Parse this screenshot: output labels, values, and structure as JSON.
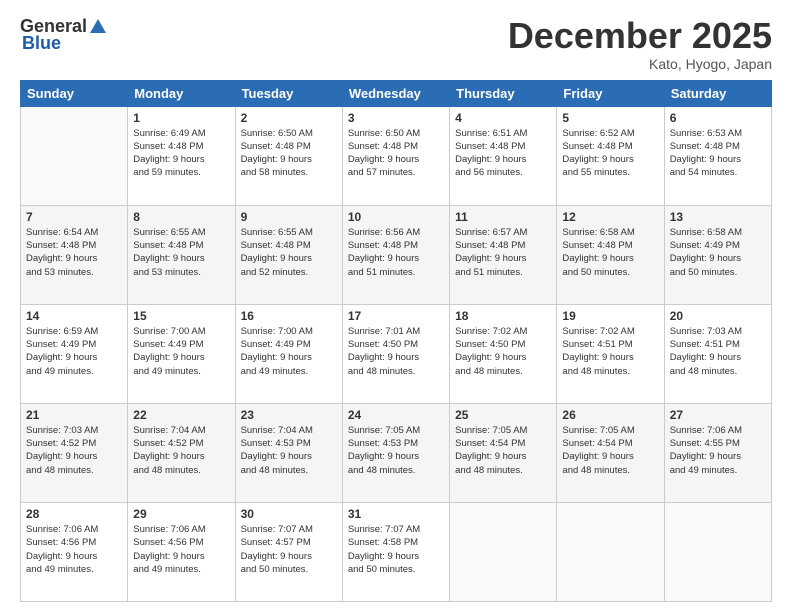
{
  "logo": {
    "general": "General",
    "blue": "Blue"
  },
  "title": "December 2025",
  "location": "Kato, Hyogo, Japan",
  "days_header": [
    "Sunday",
    "Monday",
    "Tuesday",
    "Wednesday",
    "Thursday",
    "Friday",
    "Saturday"
  ],
  "weeks": [
    [
      {
        "num": "",
        "info": ""
      },
      {
        "num": "1",
        "info": "Sunrise: 6:49 AM\nSunset: 4:48 PM\nDaylight: 9 hours\nand 59 minutes."
      },
      {
        "num": "2",
        "info": "Sunrise: 6:50 AM\nSunset: 4:48 PM\nDaylight: 9 hours\nand 58 minutes."
      },
      {
        "num": "3",
        "info": "Sunrise: 6:50 AM\nSunset: 4:48 PM\nDaylight: 9 hours\nand 57 minutes."
      },
      {
        "num": "4",
        "info": "Sunrise: 6:51 AM\nSunset: 4:48 PM\nDaylight: 9 hours\nand 56 minutes."
      },
      {
        "num": "5",
        "info": "Sunrise: 6:52 AM\nSunset: 4:48 PM\nDaylight: 9 hours\nand 55 minutes."
      },
      {
        "num": "6",
        "info": "Sunrise: 6:53 AM\nSunset: 4:48 PM\nDaylight: 9 hours\nand 54 minutes."
      }
    ],
    [
      {
        "num": "7",
        "info": "Sunrise: 6:54 AM\nSunset: 4:48 PM\nDaylight: 9 hours\nand 53 minutes."
      },
      {
        "num": "8",
        "info": "Sunrise: 6:55 AM\nSunset: 4:48 PM\nDaylight: 9 hours\nand 53 minutes."
      },
      {
        "num": "9",
        "info": "Sunrise: 6:55 AM\nSunset: 4:48 PM\nDaylight: 9 hours\nand 52 minutes."
      },
      {
        "num": "10",
        "info": "Sunrise: 6:56 AM\nSunset: 4:48 PM\nDaylight: 9 hours\nand 51 minutes."
      },
      {
        "num": "11",
        "info": "Sunrise: 6:57 AM\nSunset: 4:48 PM\nDaylight: 9 hours\nand 51 minutes."
      },
      {
        "num": "12",
        "info": "Sunrise: 6:58 AM\nSunset: 4:48 PM\nDaylight: 9 hours\nand 50 minutes."
      },
      {
        "num": "13",
        "info": "Sunrise: 6:58 AM\nSunset: 4:49 PM\nDaylight: 9 hours\nand 50 minutes."
      }
    ],
    [
      {
        "num": "14",
        "info": "Sunrise: 6:59 AM\nSunset: 4:49 PM\nDaylight: 9 hours\nand 49 minutes."
      },
      {
        "num": "15",
        "info": "Sunrise: 7:00 AM\nSunset: 4:49 PM\nDaylight: 9 hours\nand 49 minutes."
      },
      {
        "num": "16",
        "info": "Sunrise: 7:00 AM\nSunset: 4:49 PM\nDaylight: 9 hours\nand 49 minutes."
      },
      {
        "num": "17",
        "info": "Sunrise: 7:01 AM\nSunset: 4:50 PM\nDaylight: 9 hours\nand 48 minutes."
      },
      {
        "num": "18",
        "info": "Sunrise: 7:02 AM\nSunset: 4:50 PM\nDaylight: 9 hours\nand 48 minutes."
      },
      {
        "num": "19",
        "info": "Sunrise: 7:02 AM\nSunset: 4:51 PM\nDaylight: 9 hours\nand 48 minutes."
      },
      {
        "num": "20",
        "info": "Sunrise: 7:03 AM\nSunset: 4:51 PM\nDaylight: 9 hours\nand 48 minutes."
      }
    ],
    [
      {
        "num": "21",
        "info": "Sunrise: 7:03 AM\nSunset: 4:52 PM\nDaylight: 9 hours\nand 48 minutes."
      },
      {
        "num": "22",
        "info": "Sunrise: 7:04 AM\nSunset: 4:52 PM\nDaylight: 9 hours\nand 48 minutes."
      },
      {
        "num": "23",
        "info": "Sunrise: 7:04 AM\nSunset: 4:53 PM\nDaylight: 9 hours\nand 48 minutes."
      },
      {
        "num": "24",
        "info": "Sunrise: 7:05 AM\nSunset: 4:53 PM\nDaylight: 9 hours\nand 48 minutes."
      },
      {
        "num": "25",
        "info": "Sunrise: 7:05 AM\nSunset: 4:54 PM\nDaylight: 9 hours\nand 48 minutes."
      },
      {
        "num": "26",
        "info": "Sunrise: 7:05 AM\nSunset: 4:54 PM\nDaylight: 9 hours\nand 48 minutes."
      },
      {
        "num": "27",
        "info": "Sunrise: 7:06 AM\nSunset: 4:55 PM\nDaylight: 9 hours\nand 49 minutes."
      }
    ],
    [
      {
        "num": "28",
        "info": "Sunrise: 7:06 AM\nSunset: 4:56 PM\nDaylight: 9 hours\nand 49 minutes."
      },
      {
        "num": "29",
        "info": "Sunrise: 7:06 AM\nSunset: 4:56 PM\nDaylight: 9 hours\nand 49 minutes."
      },
      {
        "num": "30",
        "info": "Sunrise: 7:07 AM\nSunset: 4:57 PM\nDaylight: 9 hours\nand 50 minutes."
      },
      {
        "num": "31",
        "info": "Sunrise: 7:07 AM\nSunset: 4:58 PM\nDaylight: 9 hours\nand 50 minutes."
      },
      {
        "num": "",
        "info": ""
      },
      {
        "num": "",
        "info": ""
      },
      {
        "num": "",
        "info": ""
      }
    ]
  ]
}
